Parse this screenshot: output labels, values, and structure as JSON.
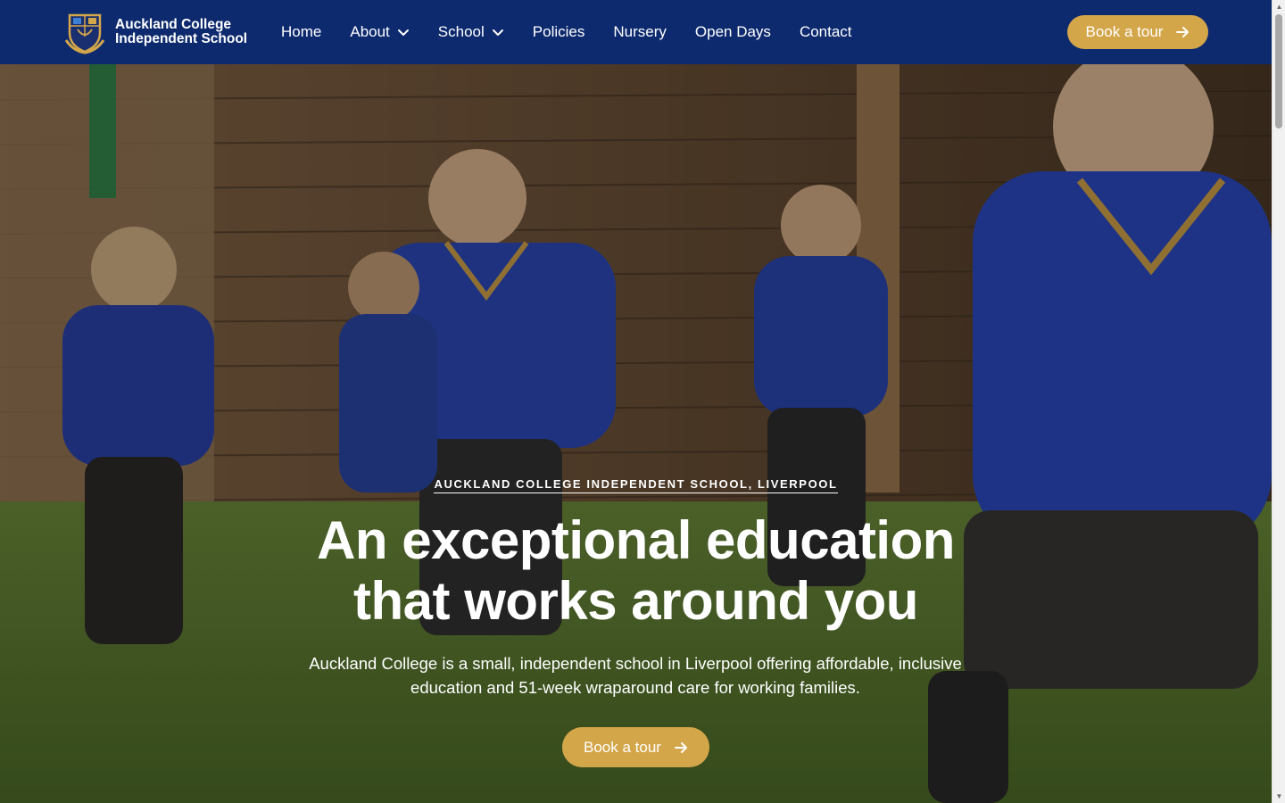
{
  "header": {
    "brand_line1": "Auckland College",
    "brand_line2": "Independent School",
    "nav": [
      {
        "label": "Home",
        "has_dropdown": false
      },
      {
        "label": "About",
        "has_dropdown": true
      },
      {
        "label": "School",
        "has_dropdown": true
      },
      {
        "label": "Policies",
        "has_dropdown": false
      },
      {
        "label": "Nursery",
        "has_dropdown": false
      },
      {
        "label": "Open Days",
        "has_dropdown": false
      },
      {
        "label": "Contact",
        "has_dropdown": false
      }
    ],
    "cta_label": "Book a tour"
  },
  "hero": {
    "eyebrow": "AUCKLAND COLLEGE INDEPENDENT SCHOOL, LIVERPOOL",
    "headline_line1": "An exceptional education",
    "headline_line2": "that works around you",
    "subtext_line1": "Auckland College is a small, independent school in Liverpool offering affordable, inclusive",
    "subtext_line2": "education and 51-week wraparound care for working families.",
    "cta_label": "Book a tour"
  },
  "colors": {
    "header_bg": "#0d2a6e",
    "accent": "#d4a64a",
    "text": "#ffffff"
  },
  "icons": [
    "crest-logo-icon",
    "chevron-down-icon",
    "arrow-right-icon"
  ]
}
